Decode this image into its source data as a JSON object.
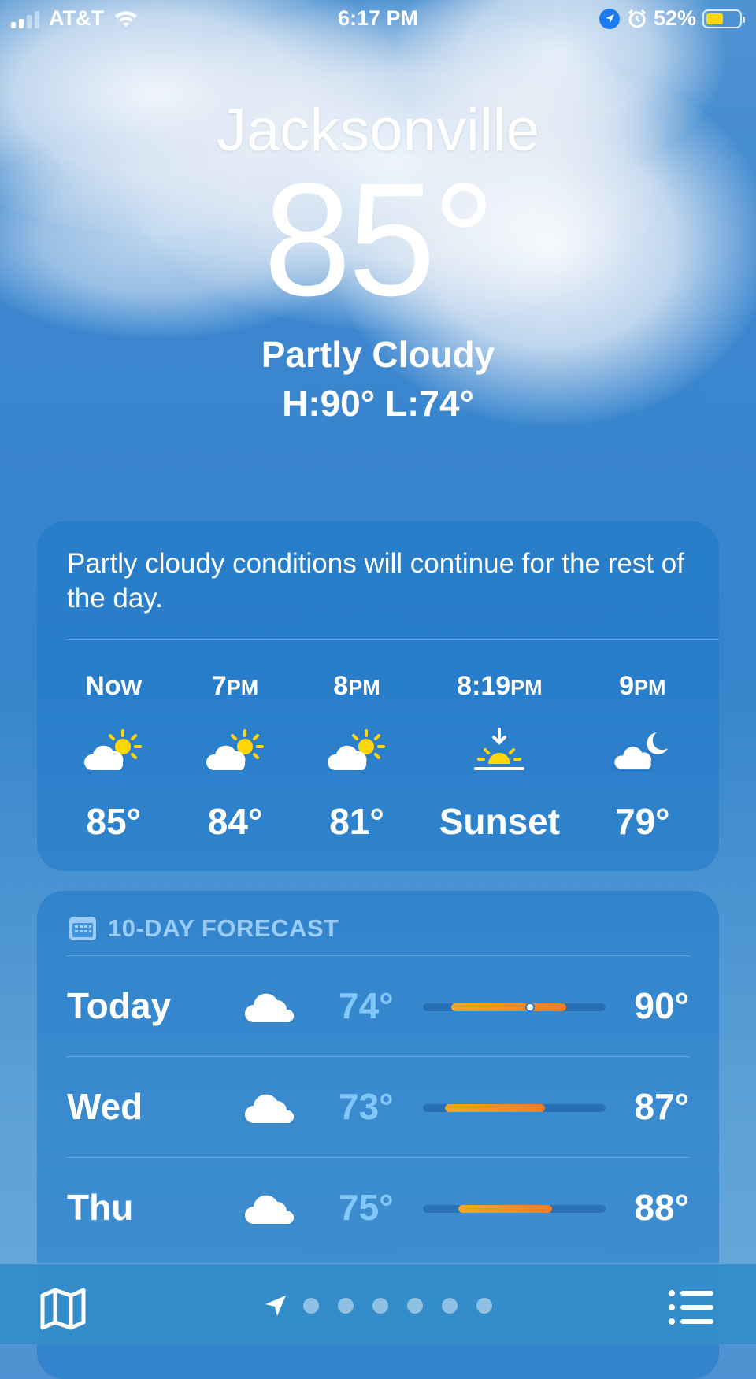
{
  "status_bar": {
    "carrier": "AT&T",
    "time": "6:17 PM",
    "battery": "52%",
    "battery_level": 0.52
  },
  "location": {
    "city": "Jacksonville",
    "temperature": "85°",
    "condition": "Partly Cloudy",
    "high_low": "H:90°  L:74°"
  },
  "hourly": {
    "summary": "Partly cloudy conditions will continue for the rest of the day.",
    "items": [
      {
        "label": "Now",
        "suffix": "",
        "icon": "partly-cloudy-sun-icon",
        "value": "85°"
      },
      {
        "label": "7",
        "suffix": "PM",
        "icon": "partly-cloudy-sun-icon",
        "value": "84°"
      },
      {
        "label": "8",
        "suffix": "PM",
        "icon": "partly-cloudy-sun-icon",
        "value": "81°"
      },
      {
        "label": "8:19",
        "suffix": "PM",
        "icon": "sunset-icon",
        "value": "Sunset"
      },
      {
        "label": "9",
        "suffix": "PM",
        "icon": "partly-cloudy-moon-icon",
        "value": "79°"
      }
    ]
  },
  "forecast": {
    "title": "10-DAY FORECAST",
    "range_min": 73,
    "range_max": 90,
    "days": [
      {
        "day": "Today",
        "icon": "cloud-icon",
        "low": "74°",
        "high": "90°",
        "low_value": 74,
        "high_value": 90,
        "current_value": 85
      },
      {
        "day": "Wed",
        "icon": "cloud-icon",
        "low": "73°",
        "high": "87°",
        "low_value": 73,
        "high_value": 87
      },
      {
        "day": "Thu",
        "icon": "cloud-icon",
        "low": "75°",
        "high": "88°",
        "low_value": 75,
        "high_value": 88
      }
    ]
  },
  "tab_bar": {
    "page_count": 6,
    "icons": [
      "map-icon",
      "location-arrow-icon",
      "list-icon"
    ]
  },
  "colors": {
    "bar_start": "#f6a623",
    "bar_end": "#f47b20",
    "battery_fill": "#ffd60a"
  }
}
